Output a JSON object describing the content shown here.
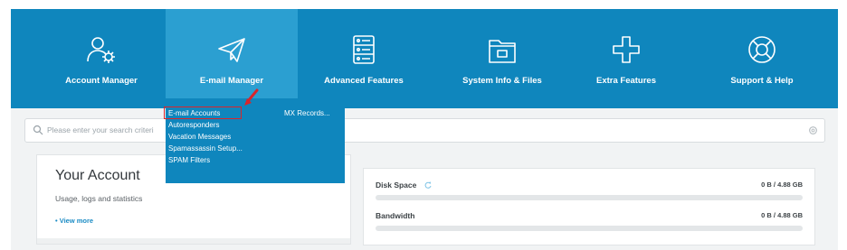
{
  "nav": {
    "items": [
      {
        "label": "Account Manager",
        "icon": "user-gear-icon"
      },
      {
        "label": "E-mail Manager",
        "icon": "paper-plane-icon"
      },
      {
        "label": "Advanced Features",
        "icon": "server-icon"
      },
      {
        "label": "System Info & Files",
        "icon": "folder-icon"
      },
      {
        "label": "Extra Features",
        "icon": "plus-icon"
      },
      {
        "label": "Support & Help",
        "icon": "lifebuoy-icon"
      }
    ],
    "active_index": 1
  },
  "dropdown": {
    "col1": [
      "E-mail Accounts",
      "Autoresponders",
      "Vacation Messages",
      "Spamassassin Setup...",
      "SPAM Filters"
    ],
    "col2": [
      "MX Records..."
    ]
  },
  "search": {
    "placeholder": "Please enter your search criteri"
  },
  "account": {
    "title": "Your Account",
    "subtitle": "Usage, logs and statistics",
    "view_more": "• View more"
  },
  "usage": [
    {
      "name": "Disk Space",
      "value": "0 B / 4.88 GB",
      "fraction": 0
    },
    {
      "name": "Bandwidth",
      "value": "0 B / 4.88 GB",
      "fraction": 0
    }
  ],
  "colors": {
    "brand": "#0f86bd",
    "active_tab": "#2b9fd1",
    "highlight": "#d9252b"
  }
}
